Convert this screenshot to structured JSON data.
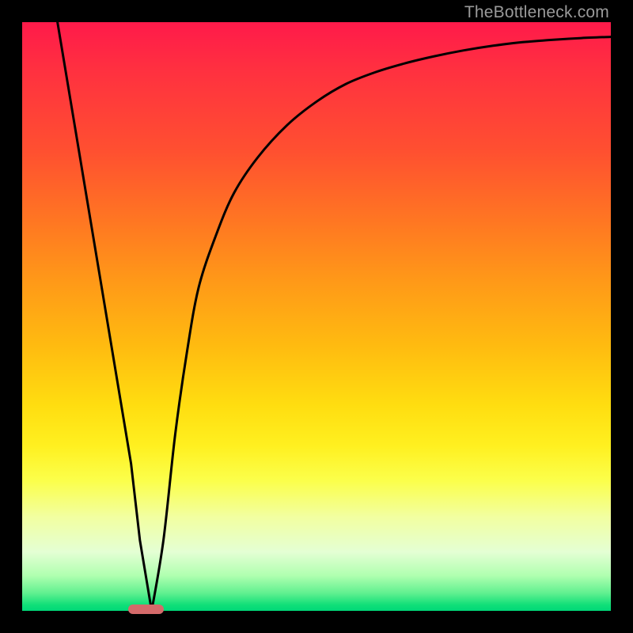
{
  "watermark": "TheBottleneck.com",
  "chart_data": {
    "type": "line",
    "title": "",
    "xlabel": "",
    "ylabel": "",
    "xlim": [
      0,
      100
    ],
    "ylim": [
      0,
      100
    ],
    "gradient_stops": [
      {
        "pct": 0,
        "color": "#ff1a4a"
      },
      {
        "pct": 8,
        "color": "#ff3040"
      },
      {
        "pct": 22,
        "color": "#ff5030"
      },
      {
        "pct": 34,
        "color": "#ff7722"
      },
      {
        "pct": 44,
        "color": "#ff9918"
      },
      {
        "pct": 55,
        "color": "#ffbb10"
      },
      {
        "pct": 65,
        "color": "#ffdd10"
      },
      {
        "pct": 72,
        "color": "#fff020"
      },
      {
        "pct": 78,
        "color": "#fbff4c"
      },
      {
        "pct": 84,
        "color": "#f2ffa0"
      },
      {
        "pct": 90,
        "color": "#e4ffd4"
      },
      {
        "pct": 94,
        "color": "#b0ffb0"
      },
      {
        "pct": 97,
        "color": "#60f090"
      },
      {
        "pct": 99,
        "color": "#10df78"
      },
      {
        "pct": 100,
        "color": "#00d878"
      }
    ],
    "series": [
      {
        "name": "v-curve",
        "x": [
          6,
          7,
          9,
          11,
          13,
          15,
          17,
          18.5,
          20,
          22,
          24,
          26,
          28,
          30,
          33,
          36,
          40,
          45,
          50,
          55,
          60,
          65,
          70,
          75,
          80,
          85,
          90,
          95,
          100
        ],
        "y": [
          100,
          94,
          82,
          70,
          58,
          46,
          34,
          25,
          12,
          0,
          12,
          30,
          44,
          55,
          64,
          71,
          77,
          82.5,
          86.5,
          89.5,
          91.5,
          93,
          94.2,
          95.2,
          96,
          96.6,
          97,
          97.3,
          97.5
        ]
      }
    ],
    "marker": {
      "x_start": 18,
      "x_end": 24,
      "y": 0,
      "color": "#d46a6a"
    }
  }
}
